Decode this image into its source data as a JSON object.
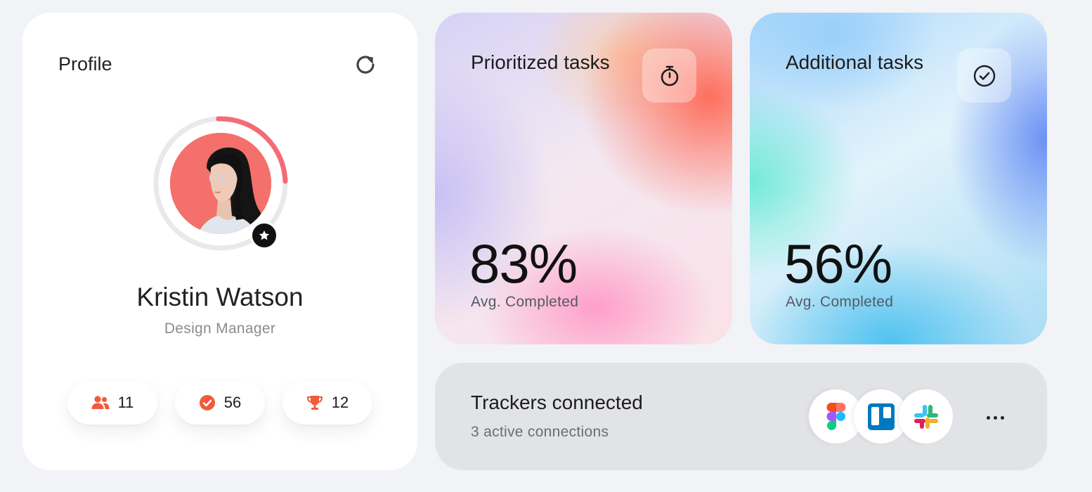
{
  "profile": {
    "title": "Profile",
    "name": "Kristin Watson",
    "role": "Design Manager",
    "progress": 0.25,
    "stats": [
      {
        "icon": "people-icon",
        "value": "11"
      },
      {
        "icon": "check-circle-icon",
        "value": "56"
      },
      {
        "icon": "trophy-icon",
        "value": "12"
      }
    ]
  },
  "tasks": [
    {
      "title": "Prioritized tasks",
      "value": "83%",
      "subtitle": "Avg. Completed",
      "icon": "stopwatch-icon"
    },
    {
      "title": "Additional tasks",
      "value": "56%",
      "subtitle": "Avg. Completed",
      "icon": "check-circle-icon"
    }
  ],
  "trackers": {
    "title": "Trackers connected",
    "subtitle": "3 active connections",
    "apps": [
      "figma-icon",
      "trello-icon",
      "slack-icon"
    ]
  },
  "colors": {
    "accent": "#f15a3a",
    "ring": "#f46b76",
    "ring_track": "#e9e9ec",
    "card_bg": "#ffffff",
    "page_bg": "#f2f3f6"
  }
}
